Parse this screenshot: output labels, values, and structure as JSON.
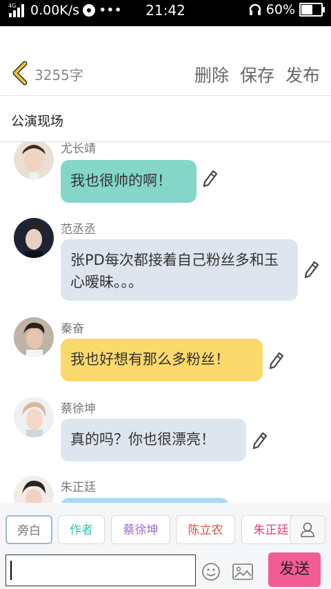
{
  "status_bar": {
    "network_type": "4G",
    "speed": "0.00K/s",
    "time": "21:42",
    "battery": "60%",
    "battery_level": 0.6
  },
  "header": {
    "word_count": "3255字",
    "delete_label": "删除",
    "save_label": "保存",
    "publish_label": "发布"
  },
  "title": "公演现场",
  "messages": [
    {
      "name": "尤长靖",
      "text": "我也很帅的啊！",
      "bubble_color": "#84d6c9"
    },
    {
      "name": "范丞丞",
      "text": "张PD每次都接着自己粉丝多和玉心暧昧。。。",
      "bubble_color": "#dfe5ee"
    },
    {
      "name": "秦奋",
      "text": "我也好想有那么多粉丝！",
      "bubble_color": "#fcd96c"
    },
    {
      "name": "蔡徐坤",
      "text": "真的吗？你也很漂亮！",
      "bubble_color": "#dfe5ee"
    },
    {
      "name": "朱正廷",
      "text": "",
      "bubble_color": "#a9d9f4"
    }
  ],
  "roles": [
    {
      "label": "旁白",
      "color": "#777777"
    },
    {
      "label": "作者",
      "color": "#3cc0b0"
    },
    {
      "label": "蔡徐坤",
      "color": "#a06ad0"
    },
    {
      "label": "陈立农",
      "color": "#e04a3a"
    },
    {
      "label": "朱正廷",
      "color": "#e0407a"
    }
  ],
  "composer": {
    "send_label": "发送"
  },
  "colors": {
    "send_button": "#f25c95",
    "back_arrow": "#f2c232"
  }
}
